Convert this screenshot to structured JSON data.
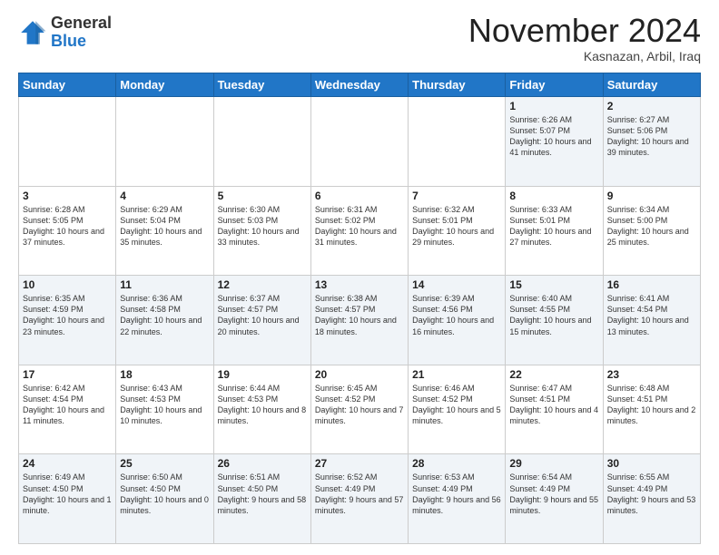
{
  "logo": {
    "general": "General",
    "blue": "Blue"
  },
  "title": "November 2024",
  "location": "Kasnazan, Arbil, Iraq",
  "days_of_week": [
    "Sunday",
    "Monday",
    "Tuesday",
    "Wednesday",
    "Thursday",
    "Friday",
    "Saturday"
  ],
  "weeks": [
    [
      {
        "day": "",
        "info": ""
      },
      {
        "day": "",
        "info": ""
      },
      {
        "day": "",
        "info": ""
      },
      {
        "day": "",
        "info": ""
      },
      {
        "day": "",
        "info": ""
      },
      {
        "day": "1",
        "info": "Sunrise: 6:26 AM\nSunset: 5:07 PM\nDaylight: 10 hours and 41 minutes."
      },
      {
        "day": "2",
        "info": "Sunrise: 6:27 AM\nSunset: 5:06 PM\nDaylight: 10 hours and 39 minutes."
      }
    ],
    [
      {
        "day": "3",
        "info": "Sunrise: 6:28 AM\nSunset: 5:05 PM\nDaylight: 10 hours and 37 minutes."
      },
      {
        "day": "4",
        "info": "Sunrise: 6:29 AM\nSunset: 5:04 PM\nDaylight: 10 hours and 35 minutes."
      },
      {
        "day": "5",
        "info": "Sunrise: 6:30 AM\nSunset: 5:03 PM\nDaylight: 10 hours and 33 minutes."
      },
      {
        "day": "6",
        "info": "Sunrise: 6:31 AM\nSunset: 5:02 PM\nDaylight: 10 hours and 31 minutes."
      },
      {
        "day": "7",
        "info": "Sunrise: 6:32 AM\nSunset: 5:01 PM\nDaylight: 10 hours and 29 minutes."
      },
      {
        "day": "8",
        "info": "Sunrise: 6:33 AM\nSunset: 5:01 PM\nDaylight: 10 hours and 27 minutes."
      },
      {
        "day": "9",
        "info": "Sunrise: 6:34 AM\nSunset: 5:00 PM\nDaylight: 10 hours and 25 minutes."
      }
    ],
    [
      {
        "day": "10",
        "info": "Sunrise: 6:35 AM\nSunset: 4:59 PM\nDaylight: 10 hours and 23 minutes."
      },
      {
        "day": "11",
        "info": "Sunrise: 6:36 AM\nSunset: 4:58 PM\nDaylight: 10 hours and 22 minutes."
      },
      {
        "day": "12",
        "info": "Sunrise: 6:37 AM\nSunset: 4:57 PM\nDaylight: 10 hours and 20 minutes."
      },
      {
        "day": "13",
        "info": "Sunrise: 6:38 AM\nSunset: 4:57 PM\nDaylight: 10 hours and 18 minutes."
      },
      {
        "day": "14",
        "info": "Sunrise: 6:39 AM\nSunset: 4:56 PM\nDaylight: 10 hours and 16 minutes."
      },
      {
        "day": "15",
        "info": "Sunrise: 6:40 AM\nSunset: 4:55 PM\nDaylight: 10 hours and 15 minutes."
      },
      {
        "day": "16",
        "info": "Sunrise: 6:41 AM\nSunset: 4:54 PM\nDaylight: 10 hours and 13 minutes."
      }
    ],
    [
      {
        "day": "17",
        "info": "Sunrise: 6:42 AM\nSunset: 4:54 PM\nDaylight: 10 hours and 11 minutes."
      },
      {
        "day": "18",
        "info": "Sunrise: 6:43 AM\nSunset: 4:53 PM\nDaylight: 10 hours and 10 minutes."
      },
      {
        "day": "19",
        "info": "Sunrise: 6:44 AM\nSunset: 4:53 PM\nDaylight: 10 hours and 8 minutes."
      },
      {
        "day": "20",
        "info": "Sunrise: 6:45 AM\nSunset: 4:52 PM\nDaylight: 10 hours and 7 minutes."
      },
      {
        "day": "21",
        "info": "Sunrise: 6:46 AM\nSunset: 4:52 PM\nDaylight: 10 hours and 5 minutes."
      },
      {
        "day": "22",
        "info": "Sunrise: 6:47 AM\nSunset: 4:51 PM\nDaylight: 10 hours and 4 minutes."
      },
      {
        "day": "23",
        "info": "Sunrise: 6:48 AM\nSunset: 4:51 PM\nDaylight: 10 hours and 2 minutes."
      }
    ],
    [
      {
        "day": "24",
        "info": "Sunrise: 6:49 AM\nSunset: 4:50 PM\nDaylight: 10 hours and 1 minute."
      },
      {
        "day": "25",
        "info": "Sunrise: 6:50 AM\nSunset: 4:50 PM\nDaylight: 10 hours and 0 minutes."
      },
      {
        "day": "26",
        "info": "Sunrise: 6:51 AM\nSunset: 4:50 PM\nDaylight: 9 hours and 58 minutes."
      },
      {
        "day": "27",
        "info": "Sunrise: 6:52 AM\nSunset: 4:49 PM\nDaylight: 9 hours and 57 minutes."
      },
      {
        "day": "28",
        "info": "Sunrise: 6:53 AM\nSunset: 4:49 PM\nDaylight: 9 hours and 56 minutes."
      },
      {
        "day": "29",
        "info": "Sunrise: 6:54 AM\nSunset: 4:49 PM\nDaylight: 9 hours and 55 minutes."
      },
      {
        "day": "30",
        "info": "Sunrise: 6:55 AM\nSunset: 4:49 PM\nDaylight: 9 hours and 53 minutes."
      }
    ]
  ]
}
